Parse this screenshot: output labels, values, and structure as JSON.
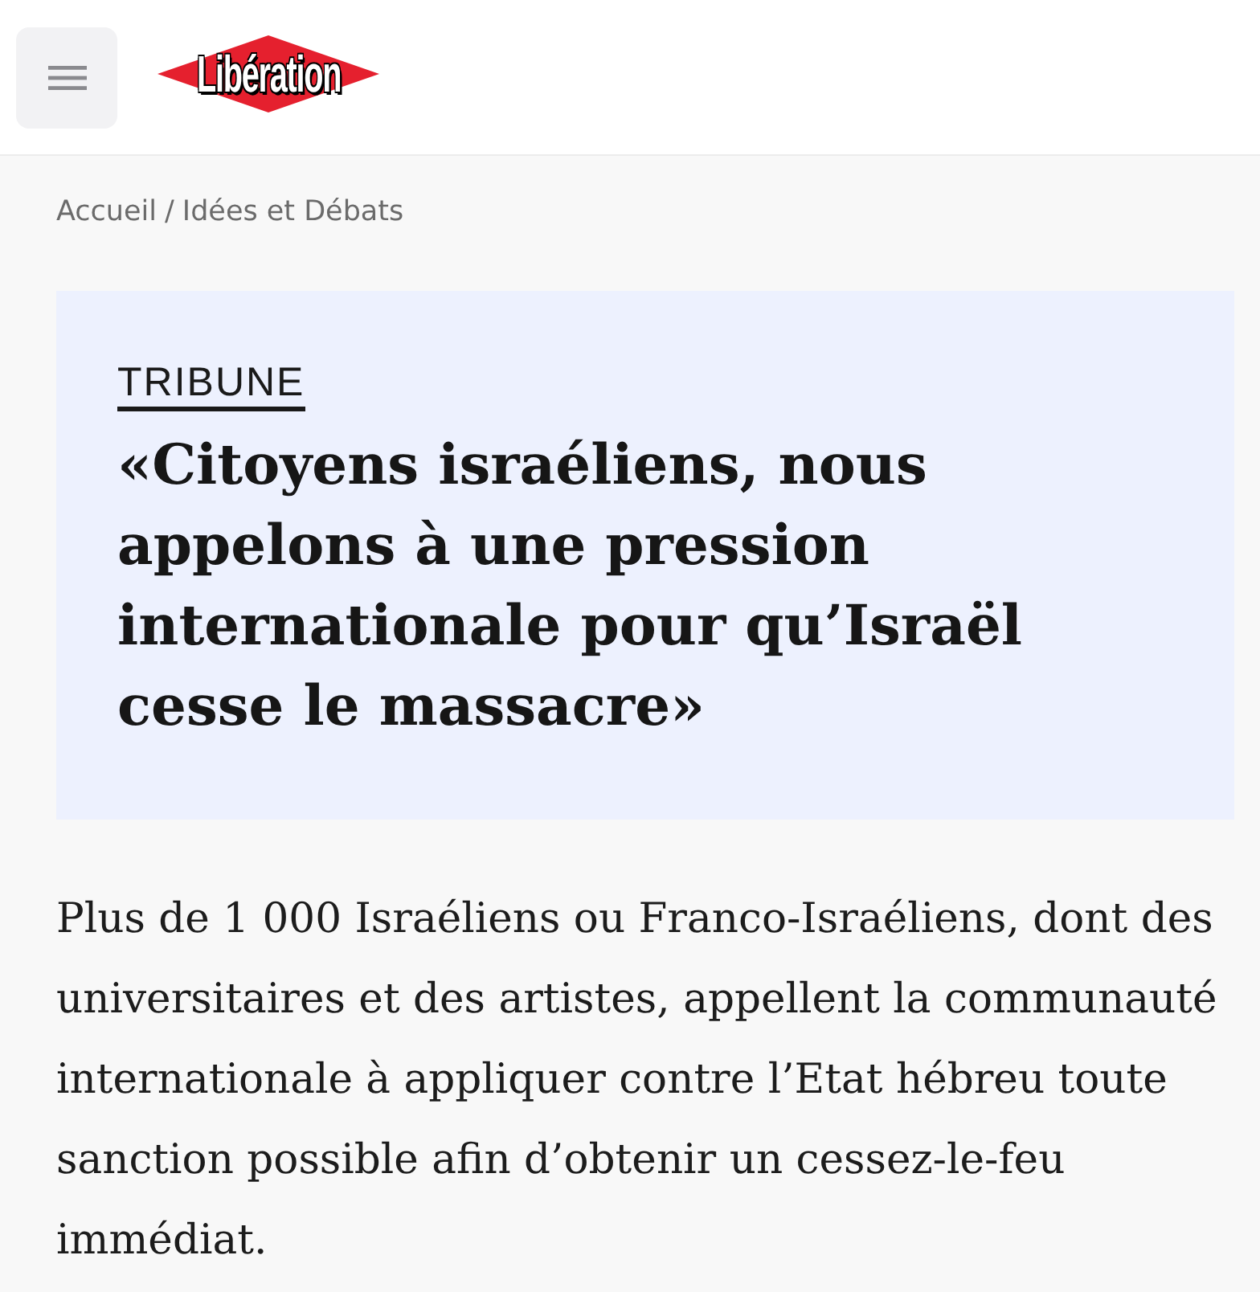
{
  "header": {
    "logo": "Libération"
  },
  "breadcrumb": {
    "items": [
      "Accueil",
      "Idées et Débats"
    ],
    "separator": "/"
  },
  "article": {
    "kicker": "TRIBUNE",
    "title": "«Citoyens israéliens, nous appelons à une pression internationale pour qu’Israël cesse le massacre»",
    "lead": "Plus de 1 000 Israéliens ou Franco-Israéliens, dont des universitaires et des artistes, appellent la communauté internationale à appliquer contre l’Etat hébreu toute sanction possible afin d’obtenir un cessez-le-feu immédiat."
  }
}
